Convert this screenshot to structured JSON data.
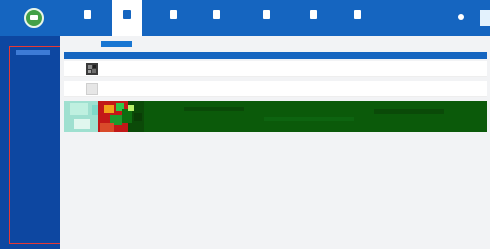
{
  "colors": {
    "topbar": "#1565c0",
    "sidebar": "#0d47a1",
    "sidebar_active": "#3d7bd6",
    "accent": "#1976d2",
    "sidebar_outline": "#e53935",
    "content_bg": "#f2f3f5"
  },
  "icons": {
    "logo": "app-logo-icon",
    "notification": "bell-icon"
  },
  "nav": {
    "tabs": [
      {
        "label": "",
        "icon": "monitor-icon",
        "active": false
      },
      {
        "label": "",
        "icon": "person-icon",
        "active": true
      },
      {
        "label": "",
        "icon": "document-icon",
        "active": false
      },
      {
        "label": "",
        "icon": "clipboard-icon",
        "active": false
      },
      {
        "label": "",
        "icon": "chart-icon",
        "active": false
      },
      {
        "label": "",
        "icon": "phone-icon",
        "active": false
      },
      {
        "label": "",
        "icon": "settings-icon",
        "active": false
      }
    ]
  },
  "sidebar": {
    "items": [
      {
        "label": "",
        "active": true
      },
      {
        "label": "",
        "active": false
      },
      {
        "label": "",
        "active": false
      },
      {
        "label": "",
        "active": false
      },
      {
        "label": "",
        "active": false
      },
      {
        "label": "",
        "active": false
      },
      {
        "label": "",
        "active": false
      },
      {
        "label": "",
        "active": false
      },
      {
        "label": "",
        "active": false
      },
      {
        "label": "",
        "active": false
      },
      {
        "label": "",
        "active": false
      },
      {
        "label": "",
        "active": false
      },
      {
        "label": "",
        "active": false
      },
      {
        "label": "",
        "active": false
      },
      {
        "label": "",
        "active": false
      },
      {
        "label": "",
        "active": false
      }
    ]
  },
  "toolbar": {
    "filter_label": "",
    "add_button_label": ""
  },
  "table": {
    "columns": [
      "",
      "",
      "",
      "",
      "",
      "",
      ""
    ],
    "rows": [
      {
        "cells": [
          "",
          "",
          "",
          "",
          ""
        ],
        "actions": ""
      },
      {
        "cells": [
          "",
          "",
          "",
          "",
          ""
        ],
        "actions": ""
      }
    ]
  }
}
